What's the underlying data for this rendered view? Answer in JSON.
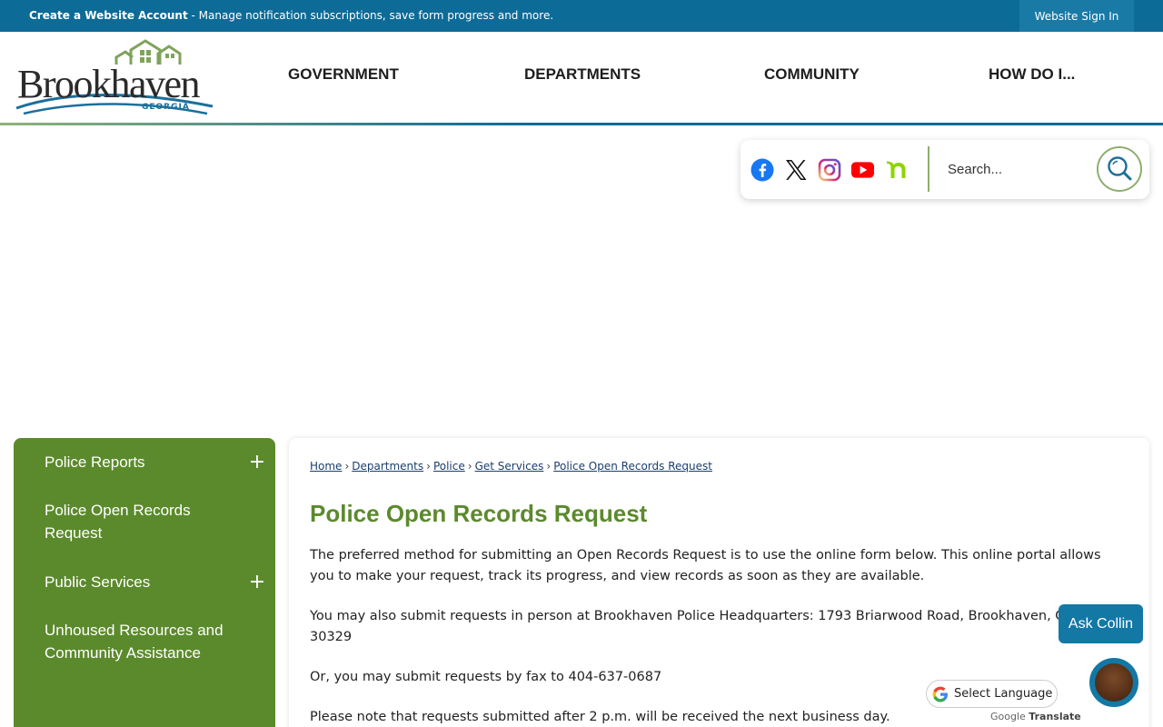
{
  "topbar": {
    "account_bold": "Create a Website Account",
    "account_text": " - Manage notification subscriptions, save form progress and more.",
    "signin_label": "Website Sign In"
  },
  "logo": {
    "word": "Brookhaven",
    "state": "GEORGIA"
  },
  "nav": {
    "items": [
      {
        "label": "GOVERNMENT"
      },
      {
        "label": "DEPARTMENTS"
      },
      {
        "label": "COMMUNITY"
      },
      {
        "label": "HOW DO I..."
      }
    ]
  },
  "social": {
    "icons": [
      "facebook-icon",
      "x-icon",
      "instagram-icon",
      "youtube-icon",
      "nextdoor-icon"
    ]
  },
  "search": {
    "placeholder": "Search..."
  },
  "sidebar": {
    "items": [
      {
        "label": "Police Reports",
        "expandable": true
      },
      {
        "label": "Police Open Records Request",
        "expandable": false
      },
      {
        "label": "Public Services",
        "expandable": true
      },
      {
        "label": "Unhoused Resources and Community Assistance",
        "expandable": false
      }
    ],
    "plus_symbol": "+"
  },
  "breadcrumb": {
    "items": [
      "Home",
      "Departments",
      "Police",
      "Get Services",
      "Police Open Records Request"
    ],
    "separator": "›"
  },
  "main": {
    "title": "Police Open Records Request",
    "paragraphs": [
      "The preferred method for submitting an Open Records Request is to use the online form below. This online portal allows you to make your request, track its progress, and view records as soon as they are available.",
      "You may also submit requests in person at Brookhaven Police Headquarters: 1793 Briarwood Road, Brookhaven, Georgia 30329",
      "Or, you may submit requests by fax to 404-637-0687",
      "Please note that requests submitted after 2 p.m. will be received the next business day."
    ]
  },
  "widgets": {
    "ask_label": "Ask Collin",
    "language_label": "Select Language",
    "powered_prefix": "Google",
    "powered_suffix": "Translate"
  },
  "colors": {
    "brand_blue": "#0d6b97",
    "brand_green": "#5b8a2c"
  }
}
